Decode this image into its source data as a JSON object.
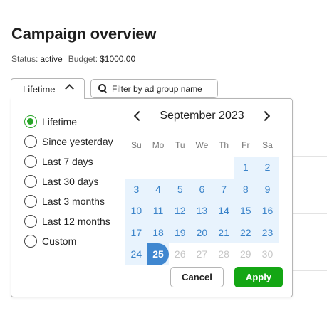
{
  "page": {
    "title": "Campaign overview"
  },
  "meta": {
    "status_label": "Status:",
    "status_value": "active",
    "budget_label": "Budget:",
    "budget_value": "$1000.00"
  },
  "date_range": {
    "selected_label": "Lifetime"
  },
  "filter": {
    "placeholder": "Filter by ad group name"
  },
  "presets": [
    {
      "label": "Lifetime",
      "selected": true
    },
    {
      "label": "Since yesterday",
      "selected": false
    },
    {
      "label": "Last 7 days",
      "selected": false
    },
    {
      "label": "Last 30 days",
      "selected": false
    },
    {
      "label": "Last 3 months",
      "selected": false
    },
    {
      "label": "Last 12 months",
      "selected": false
    },
    {
      "label": "Custom",
      "selected": false
    }
  ],
  "calendar": {
    "month_label": "September 2023",
    "weekdays": [
      "Su",
      "Mo",
      "Tu",
      "We",
      "Th",
      "Fr",
      "Sa"
    ],
    "weeks": [
      [
        "",
        "",
        "",
        "",
        "",
        "1",
        "2"
      ],
      [
        "3",
        "4",
        "5",
        "6",
        "7",
        "8",
        "9"
      ],
      [
        "10",
        "11",
        "12",
        "13",
        "14",
        "15",
        "16"
      ],
      [
        "17",
        "18",
        "19",
        "20",
        "21",
        "22",
        "23"
      ],
      [
        "24",
        "25",
        "26",
        "27",
        "28",
        "29",
        "30"
      ]
    ],
    "selected_day": "25",
    "range_start_day": "1",
    "range_end_day": "25"
  },
  "actions": {
    "cancel_label": "Cancel",
    "apply_label": "Apply"
  },
  "colors": {
    "accent_green": "#14a614",
    "accent_blue": "#3f87d0",
    "range_bg": "#e8f3fd",
    "day_text": "#3a83c9",
    "disabled_text": "#c6c6c6"
  }
}
